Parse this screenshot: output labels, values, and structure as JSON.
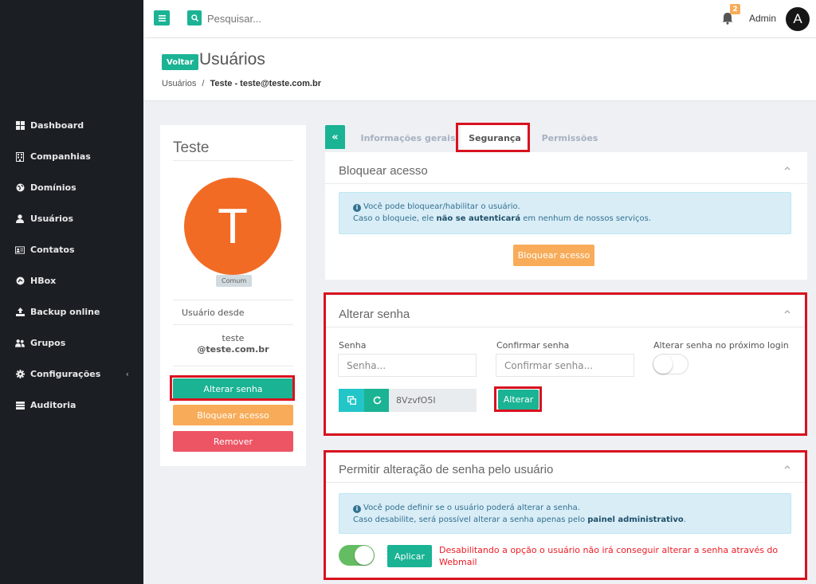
{
  "topbar": {
    "search_placeholder": "Pesquisar...",
    "notification_count": "2",
    "user_name": "Admin",
    "avatar_letter": "A"
  },
  "sidebar": {
    "items": [
      {
        "label": "Dashboard",
        "icon": "grid-icon"
      },
      {
        "label": "Companhias",
        "icon": "building-icon"
      },
      {
        "label": "Domínios",
        "icon": "globe-icon"
      },
      {
        "label": "Usuários",
        "icon": "user-icon"
      },
      {
        "label": "Contatos",
        "icon": "contact-card-icon"
      },
      {
        "label": "HBox",
        "icon": "hbox-icon"
      },
      {
        "label": "Backup online",
        "icon": "upload-icon"
      },
      {
        "label": "Grupos",
        "icon": "users-icon"
      },
      {
        "label": "Configurações",
        "icon": "gear-icon",
        "chevron": "‹"
      },
      {
        "label": "Auditoria",
        "icon": "list-icon"
      }
    ]
  },
  "header": {
    "back_label": "Voltar",
    "title": "Usuários",
    "breadcrumb_root": "Usuários",
    "breadcrumb_separator": "/",
    "breadcrumb_current": "Teste - teste@teste.com.br"
  },
  "profile": {
    "name": "Teste",
    "avatar_letter": "T",
    "avatar_color": "#f26b25",
    "role": "Comum",
    "since_label": "Usuário desde",
    "login": "teste",
    "domain": "@teste.com.br",
    "buttons": {
      "change_password": "Alterar senha",
      "block_access": "Bloquear acesso",
      "remove": "Remover"
    }
  },
  "tabs": {
    "collapse_symbol": "«",
    "items": [
      "Informações gerais",
      "Segurança",
      "Permissões"
    ],
    "active": "Segurança"
  },
  "block_panel": {
    "title": "Bloquear acesso",
    "info_line1": "Você pode bloquear/habilitar o usuário.",
    "info_line2_prefix": "Caso o bloqueie, ele ",
    "info_line2_bold": "não se autenticará",
    "info_line2_suffix": " em nenhum de nossos serviços.",
    "button": "Bloquear acesso"
  },
  "password_panel": {
    "title": "Alterar senha",
    "password_label": "Senha",
    "password_placeholder": "Senha...",
    "confirm_label": "Confirmar senha",
    "confirm_placeholder": "Confirmar senha...",
    "next_login_label": "Alterar senha no próximo login",
    "next_login_enabled": false,
    "generated_password": "8VzvfO5I",
    "submit": "Alterar"
  },
  "allow_change_panel": {
    "title": "Permitir alteração de senha pelo usuário",
    "info_line1": "Você pode definir se o usuário poderá alterar a senha.",
    "info_line2_prefix": "Caso desabilite, será possível alterar a senha apenas pelo ",
    "info_line2_bold": "painel administrativo",
    "info_line2_suffix": ".",
    "enabled": true,
    "apply": "Aplicar",
    "warning": "Desabilitando a opção o usuário não irá conseguir alterar a senha através do Webmail"
  },
  "colors": {
    "accent": "#1ab394",
    "warning": "#f8ac59",
    "danger": "#ed5565",
    "sidebar_bg": "#1b1f24",
    "highlight": "#d8121f"
  }
}
